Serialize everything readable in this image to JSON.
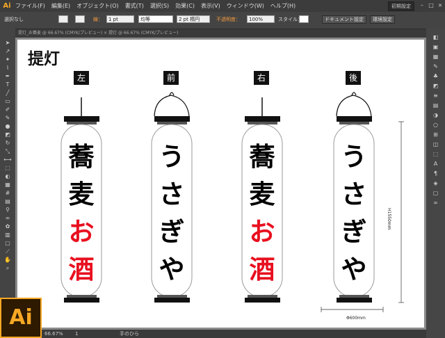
{
  "app": {
    "icon": "Ai",
    "workspace": "初期設定"
  },
  "menus": [
    "ファイル(F)",
    "編集(E)",
    "オブジェクト(O)",
    "書式(T)",
    "選択(S)",
    "効果(C)",
    "表示(V)",
    "ウィンドウ(W)",
    "ヘルプ(H)"
  ],
  "control": {
    "selection": "選択なし",
    "stroke_label": "線：",
    "stroke_weight": "1 pt",
    "line_style": "均等",
    "brush": "2 pt 楕円",
    "opacity_label": "不透明度：",
    "opacity": "100%",
    "style_label": "スタイル：",
    "doc_settings": "ドキュメント設定",
    "prefs": "環境設定"
  },
  "doc_tab": "提灯_お蕎麦 @ 66.67% (CMYK/プレビュー) × 提灯 @ 66.67% (CMYK/プレビュー)",
  "artboard": {
    "title": "提灯",
    "labels": [
      "左",
      "前",
      "右",
      "後"
    ],
    "lanterns": [
      {
        "chars": [
          "蕎",
          "麦",
          "お",
          "酒"
        ],
        "colors": [
          "#111111",
          "#111111",
          "#e8101f",
          "#e8101f"
        ],
        "hook": "rod"
      },
      {
        "chars": [
          "う",
          "さ",
          "ぎ",
          "や"
        ],
        "colors": [
          "#111111",
          "#111111",
          "#111111",
          "#111111"
        ],
        "hook": "arc"
      },
      {
        "chars": [
          "蕎",
          "麦",
          "お",
          "酒"
        ],
        "colors": [
          "#111111",
          "#111111",
          "#e8101f",
          "#e8101f"
        ],
        "hook": "rod"
      },
      {
        "chars": [
          "う",
          "さ",
          "ぎ",
          "や"
        ],
        "colors": [
          "#111111",
          "#111111",
          "#111111",
          "#111111"
        ],
        "hook": "arc"
      }
    ],
    "height_dim": "H1550mm",
    "width_dim": "Φ600mm"
  },
  "status": {
    "zoom": "66.67%",
    "page": "1",
    "tool": "手のひら"
  },
  "colors": {
    "accent": "#f7a825",
    "red": "#e8101f"
  }
}
